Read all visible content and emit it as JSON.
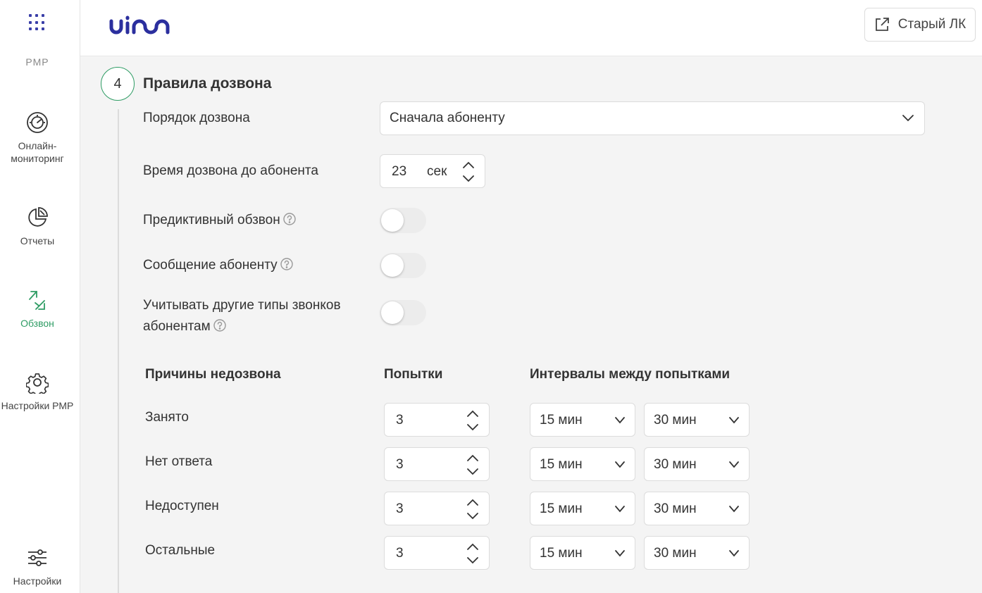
{
  "sidebar": {
    "product": "РМР",
    "items": [
      {
        "label": "Онлайн-мониторинг",
        "line1": "Онлайн-",
        "line2": "мониторинг",
        "icon": "gauge-icon"
      },
      {
        "label": "Отчеты",
        "icon": "pie-chart-icon"
      },
      {
        "label": "Обзвон",
        "icon": "outgoing-call-icon",
        "active": true
      },
      {
        "label": "Настройки РМР",
        "icon": "gear-icon"
      },
      {
        "label": "Настройки",
        "icon": "sliders-icon"
      }
    ]
  },
  "header": {
    "logo": "uis",
    "old_lk_label": "Старый ЛК",
    "old_lk_icon": "external-link-icon"
  },
  "step": {
    "number": "4",
    "title": "Правила дозвона"
  },
  "form": {
    "dial_order": {
      "label": "Порядок дозвона",
      "value": "Сначала абоненту"
    },
    "dial_time": {
      "label": "Время дозвона до абонента",
      "value": "23",
      "unit": "сек"
    },
    "predictive": {
      "label": "Предиктивный обзвон",
      "enabled": false
    },
    "message": {
      "label": "Сообщение абоненту",
      "enabled": false
    },
    "other_calls": {
      "label_line1": "Учитывать другие типы звонков",
      "label_line2": "абонентам",
      "enabled": false
    }
  },
  "table": {
    "headers": {
      "reasons": "Причины недозвона",
      "attempts": "Попытки",
      "intervals": "Интервалы между попытками"
    },
    "rows": [
      {
        "reason": "Занято",
        "attempts": "3",
        "interval1": "15 мин",
        "interval2": "30 мин"
      },
      {
        "reason": "Нет ответа",
        "attempts": "3",
        "interval1": "15 мин",
        "interval2": "30 мин"
      },
      {
        "reason": "Недоступен",
        "attempts": "3",
        "interval1": "15 мин",
        "interval2": "30 мин"
      },
      {
        "reason": "Остальные",
        "attempts": "3",
        "interval1": "15 мин",
        "interval2": "30 мин"
      }
    ]
  },
  "colors": {
    "accent": "#2e9c64",
    "brand": "#2b2f9e"
  }
}
